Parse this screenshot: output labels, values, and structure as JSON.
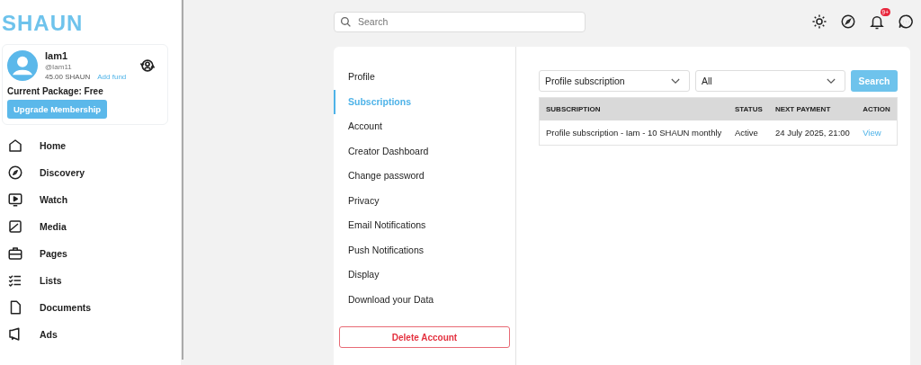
{
  "logo": "SHAUN",
  "profile": {
    "name": "Iam1",
    "handle": "@Iam11",
    "balance": "45.00 SHAUN",
    "add_fund": "Add fund",
    "package": "Current Package: Free",
    "upgrade": "Upgrade Membership"
  },
  "nav": [
    {
      "label": "Home"
    },
    {
      "label": "Discovery"
    },
    {
      "label": "Watch"
    },
    {
      "label": "Media"
    },
    {
      "label": "Pages"
    },
    {
      "label": "Lists"
    },
    {
      "label": "Documents"
    },
    {
      "label": "Ads"
    }
  ],
  "search": {
    "placeholder": "Search"
  },
  "notifications": {
    "badge": "9+"
  },
  "settings_menu": [
    {
      "label": "Profile",
      "selected": false
    },
    {
      "label": "Subscriptions",
      "selected": true
    },
    {
      "label": "Account",
      "selected": false
    },
    {
      "label": "Creator Dashboard",
      "selected": false
    },
    {
      "label": "Change password",
      "selected": false
    },
    {
      "label": "Privacy",
      "selected": false
    },
    {
      "label": "Email Notifications",
      "selected": false
    },
    {
      "label": "Push Notifications",
      "selected": false
    },
    {
      "label": "Display",
      "selected": false
    },
    {
      "label": "Download your Data",
      "selected": false
    }
  ],
  "delete_account": "Delete Account",
  "filters": {
    "type": "Profile subscription",
    "status": "All",
    "button": "Search"
  },
  "table": {
    "columns": [
      "SUBSCRIPTION",
      "STATUS",
      "NEXT PAYMENT",
      "ACTION"
    ],
    "rows": [
      {
        "subscription": "Profile subscription - Iam - 10 SHAUN monthly",
        "status": "Active",
        "next_payment": "24 July 2025, 21:00",
        "action": "View"
      }
    ]
  }
}
